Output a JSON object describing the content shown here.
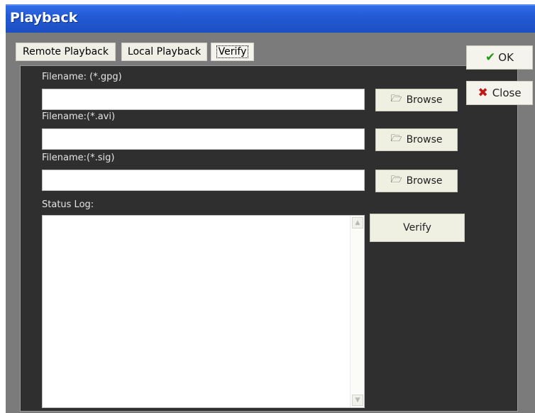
{
  "window": {
    "title": "Playback"
  },
  "tabs": [
    {
      "label": "Remote Playback"
    },
    {
      "label": "Local Playback"
    },
    {
      "label": "Verify"
    }
  ],
  "fields": [
    {
      "label": "Filename: (*.gpg)",
      "value": "",
      "browse_label": "Browse"
    },
    {
      "label": "Filename:(*.avi)",
      "value": "",
      "browse_label": "Browse"
    },
    {
      "label": "Filename:(*.sig)",
      "value": "",
      "browse_label": "Browse"
    }
  ],
  "status_log": {
    "label": "Status Log:",
    "content": ""
  },
  "verify_button": {
    "label": "Verify"
  },
  "side_buttons": {
    "ok_label": "OK",
    "close_label": "Close"
  },
  "icons": {
    "browse": "folder-open-icon",
    "ok": "checkmark-icon",
    "close": "x-mark-icon",
    "scroll_up": "chevron-up-icon",
    "scroll_down": "chevron-down-icon"
  },
  "colors": {
    "titlebar": "#2359d4",
    "panel": "#2f2f2f",
    "window_bg": "#7b7b7b",
    "ok_check": "#1f9a12",
    "close_x": "#c41818"
  }
}
